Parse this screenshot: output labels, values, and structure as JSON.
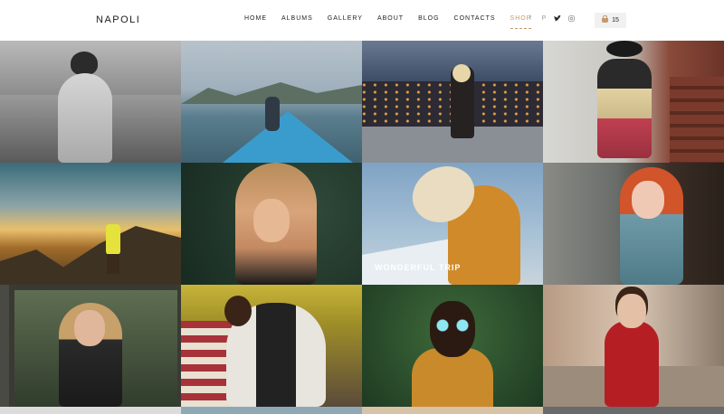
{
  "header": {
    "logo": "NAPOLI",
    "nav": [
      {
        "label": "HOME"
      },
      {
        "label": "ALBUMS"
      },
      {
        "label": "GALLERY"
      },
      {
        "label": "ABOUT"
      },
      {
        "label": "BLOG"
      },
      {
        "label": "CONTACTS"
      },
      {
        "label": "SHOP",
        "active": true
      }
    ],
    "social_icons": [
      "facebook-icon",
      "pinterest-icon",
      "twitter-icon",
      "instagram-icon"
    ],
    "cart": {
      "icon": "shopping-bag-icon",
      "count": "15"
    }
  },
  "gallery": {
    "caption": "WONDERFUL TRIP"
  },
  "colors": {
    "accent": "#c49a6c",
    "text": "#222222",
    "muted": "#9a9a9a"
  }
}
